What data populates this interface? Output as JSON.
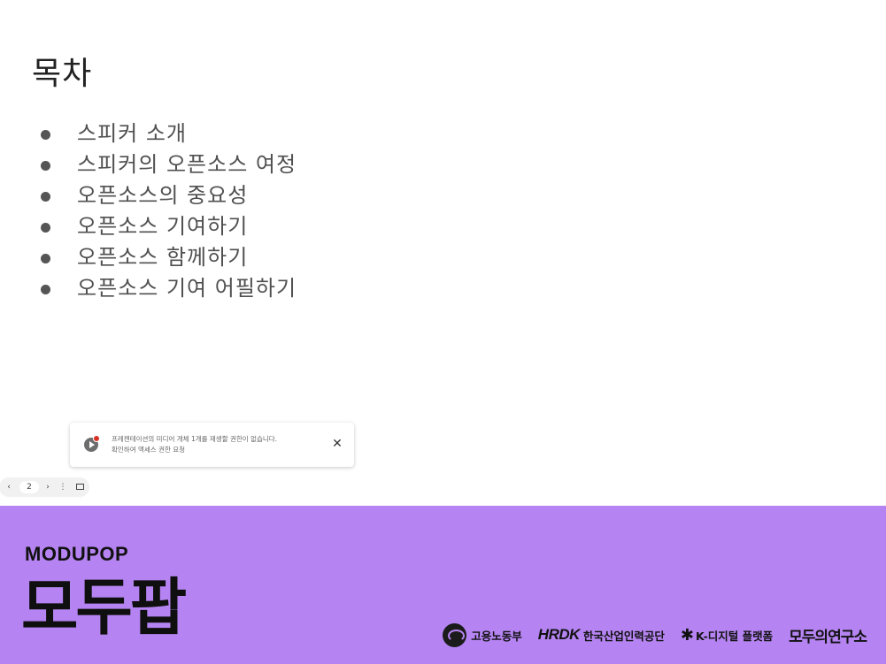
{
  "slide": {
    "title": "목차",
    "bullets": [
      "스피커 소개",
      "스피커의 오픈소스 여정",
      "오픈소스의 중요성",
      "오픈소스 기여하기",
      "오픈소스 함께하기",
      "오픈소스 기여 어필하기"
    ]
  },
  "toast": {
    "line1": "프레젠테이션의 미디어 개체 1개를 재생할 권한이 없습니다.",
    "line2": "확인하여 액세스 권한 요청",
    "close_glyph": "✕"
  },
  "pager": {
    "prev_glyph": "‹",
    "page": "2",
    "next_glyph": "›",
    "more_glyph": "⋮"
  },
  "footer": {
    "brand_en": "MODUPOP",
    "brand_ko": "모두팝",
    "partners": {
      "moel": "고용노동부",
      "hrdk_logo": "HRDK",
      "hrdk_name": "한국산업인력공단",
      "kdigital": "K-디지털 플랫폼",
      "modulabs": "모두의연구소"
    },
    "background_color": "#b584f2"
  }
}
